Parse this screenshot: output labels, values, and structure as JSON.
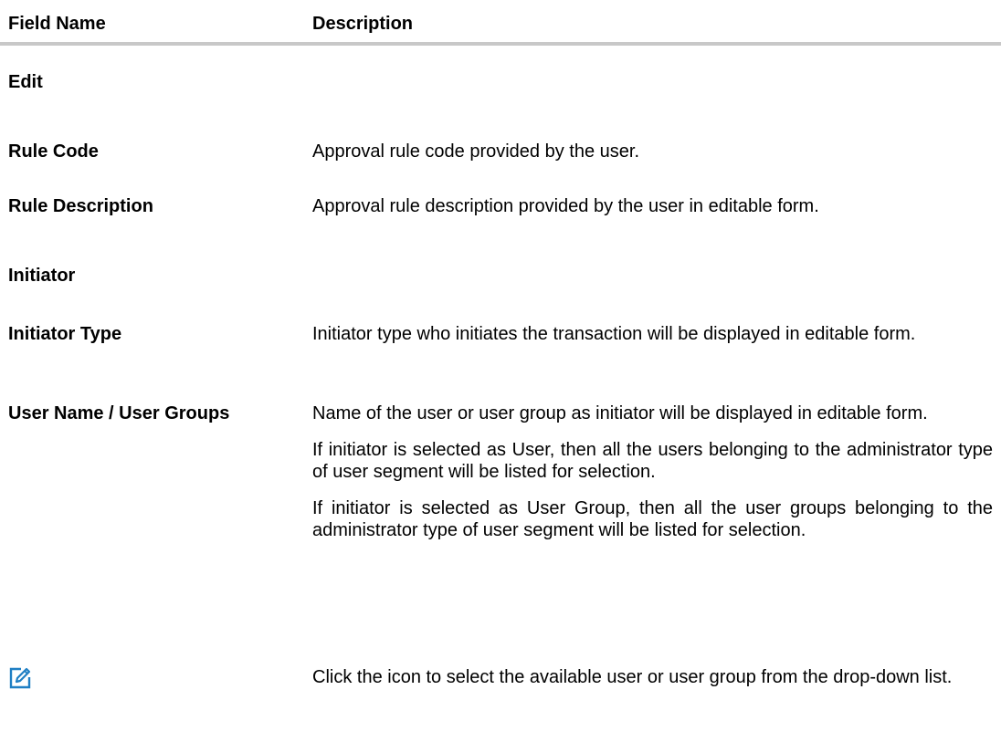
{
  "table": {
    "header": {
      "field_name": "Field Name",
      "description": "Description"
    },
    "sections": {
      "edit": "Edit",
      "initiator": "Initiator"
    },
    "rows": [
      {
        "field": "Rule Code",
        "description": [
          "Approval rule code provided by the user."
        ]
      },
      {
        "field": "Rule Description",
        "description": [
          "Approval rule description provided by the user in editable form."
        ]
      },
      {
        "field": "Initiator Type",
        "description": [
          "Initiator type who initiates the transaction will be displayed in editable form."
        ]
      },
      {
        "field": "User Name / User Groups",
        "description": [
          "Name of the user or user group as initiator will be displayed in editable form.",
          "If initiator is selected as User, then all the users belonging to the administrator type of user segment will be listed for selection.",
          "If initiator is selected as User Group, then all the user groups belonging to the administrator type of user segment will be listed for selection."
        ]
      },
      {
        "icon": "edit-icon",
        "description": [
          "Click the icon to select the available user or user group from the drop-down list."
        ]
      }
    ]
  },
  "colors": {
    "header_rule": "#c8c8c8",
    "icon_blue": "#1f7fc4"
  }
}
